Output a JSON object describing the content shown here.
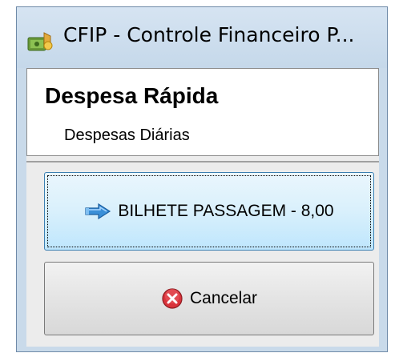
{
  "window": {
    "title": "CFIP - Controle Financeiro P...",
    "app_icon": "money-bag-icon"
  },
  "header": {
    "title": "Despesa Rápida",
    "subtitle": "Despesas Diárias"
  },
  "buttons": {
    "primary_label": "BILHETE PASSAGEM - 8,00",
    "primary_icon": "arrow-right-icon",
    "cancel_label": "Cancelar",
    "cancel_icon": "cancel-icon"
  },
  "colors": {
    "titlebar": "#c9daea",
    "primary_button": "#d9f0fc",
    "cancel_icon": "#d9333b"
  }
}
